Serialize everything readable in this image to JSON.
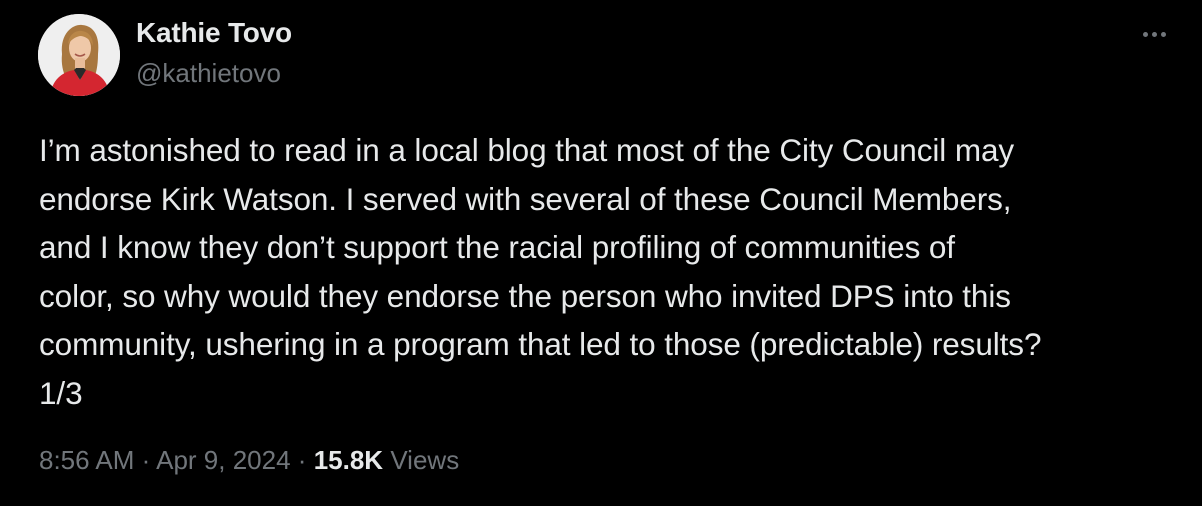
{
  "author": {
    "display_name": "Kathie Tovo",
    "handle": "@kathietovo"
  },
  "tweet": {
    "text": "I’m astonished to read in a local blog that most of the City Council may\nendorse Kirk Watson. I served with several of these Council Members,\nand I know they don’t support the racial profiling of communities of\ncolor, so why would they endorse the person who invited DPS into this\ncommunity, ushering in a program that led to those (predictable) results?\n1/3",
    "time": "8:56 AM",
    "separator": "·",
    "date": "Apr 9, 2024",
    "views_count": "15.8K",
    "views_label": "Views"
  },
  "icons": {
    "more": "more-horizontal-icon"
  },
  "colors": {
    "background": "#000000",
    "primary_text": "#e7e9ea",
    "secondary_text": "#71767b",
    "avatar_jacket": "#d42630"
  }
}
